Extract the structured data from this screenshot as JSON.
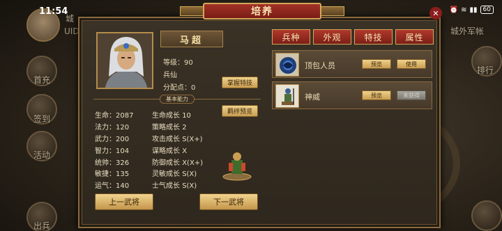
{
  "status_bar": {
    "time": "11:54",
    "battery": "60",
    "icons": [
      "close-icon",
      "wifi-icon",
      "signal-icon",
      "battery-icon"
    ]
  },
  "background": {
    "uid_label": "UID",
    "top_label": "城",
    "right_label": "城外军帐",
    "side_buttons": [
      "首充",
      "签到",
      "活动",
      "出兵"
    ],
    "right_buttons": [
      "排行"
    ]
  },
  "panel": {
    "title": "培养",
    "general": {
      "name": "马超",
      "level_label": "等级：",
      "level": "90",
      "troop_type": "兵仙",
      "points_label": "分配点：",
      "points": "0"
    },
    "buttons": {
      "master_skill": "掌握特技",
      "bond_preview": "羁绊预览",
      "prev_general": "上一武将",
      "next_general": "下一武将"
    },
    "section_title": "基本能力",
    "stats_left": [
      {
        "label": "生命：",
        "value": "2087"
      },
      {
        "label": "法力：",
        "value": "120"
      },
      {
        "label": "武力：",
        "value": "200"
      },
      {
        "label": "智力：",
        "value": "104"
      },
      {
        "label": "统帅：",
        "value": "326"
      },
      {
        "label": "敏捷：",
        "value": "135"
      },
      {
        "label": "运气：",
        "value": "140"
      }
    ],
    "stats_right": [
      {
        "label": "生命成长",
        "value": "10"
      },
      {
        "label": "策略成长",
        "value": "2"
      },
      {
        "label": "攻击成长",
        "value": "S(X+)"
      },
      {
        "label": "谋略成长",
        "value": "X"
      },
      {
        "label": "防御成长",
        "value": "X(X+)"
      },
      {
        "label": "灵敏成长",
        "value": "S(X)"
      },
      {
        "label": "士气成长",
        "value": "S(X)"
      }
    ],
    "tabs": [
      "兵种",
      "外观",
      "特技",
      "属性"
    ],
    "skins": [
      {
        "name": "顶包人员",
        "preview": "预览",
        "action": "使用",
        "action_disabled": false
      },
      {
        "name": "神威",
        "preview": "预览",
        "action": "未获得",
        "action_disabled": true
      }
    ]
  },
  "colors": {
    "accent_red": "#a23227",
    "gold": "#d3a85a",
    "button_gold": "#e6c47b"
  }
}
